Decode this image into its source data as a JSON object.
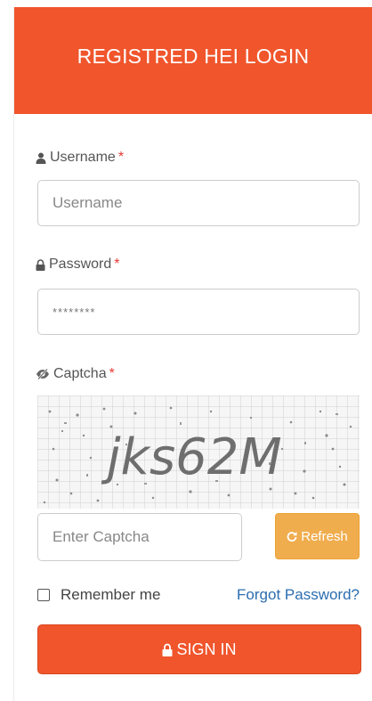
{
  "header": {
    "title": "REGISTRED HEI LOGIN"
  },
  "username": {
    "label": "Username",
    "required_mark": "*",
    "placeholder": "Username",
    "icon": "user-icon"
  },
  "password": {
    "label": "Password",
    "required_mark": "*",
    "value": "********",
    "icon": "lock-icon"
  },
  "captcha": {
    "label": "Captcha",
    "required_mark": "*",
    "icon": "eye-slash-icon",
    "image_text": "jks62M",
    "input_placeholder": "Enter Captcha",
    "refresh_label": "Refresh",
    "refresh_icon": "refresh-icon"
  },
  "remember": {
    "label": "Remember me",
    "checked": false
  },
  "forgot": {
    "label": "Forgot Password?"
  },
  "signin": {
    "label": "SIGN IN",
    "icon": "lock-icon"
  },
  "colors": {
    "primary": "#f0552c",
    "warning": "#f0ad4e",
    "link": "#2a6db0",
    "required": "#e53935"
  }
}
